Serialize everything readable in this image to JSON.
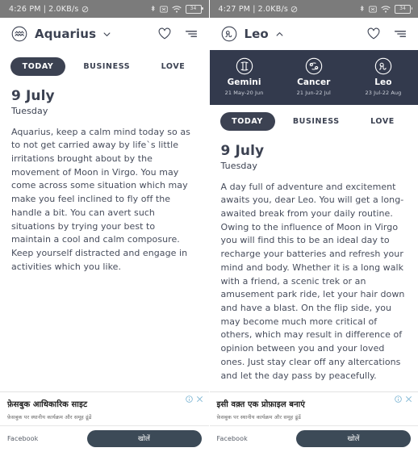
{
  "left": {
    "statusbar": {
      "time": "4:26 PM",
      "separator": "|",
      "netspeed": "2.0KB/s",
      "battery_level": "34",
      "icons": [
        "bluetooth-icon",
        "no-sim-icon",
        "wifi-icon",
        "battery-icon"
      ]
    },
    "header": {
      "sign": "Aquarius",
      "sign_icon": "aquarius-icon",
      "chevron": "chevron-down-icon",
      "favorite_icon": "heart-icon",
      "menu_icon": "filter-icon"
    },
    "tabs": [
      {
        "label": "TODAY",
        "active": true
      },
      {
        "label": "BUSINESS",
        "active": false
      },
      {
        "label": "LOVE",
        "active": false
      }
    ],
    "horoscope": {
      "date": "9 July",
      "weekday": "Tuesday",
      "text": "Aquarius, keep a calm mind today so as to not get carried away by life`s little irritations brought about by the movement of Moon in Virgo. You may come across some situation which may make you feel inclined to fly off the handle a bit. You can avert such situations by trying your best to maintain a cool and calm composure. Keep yourself distracted and engage in activities which you like."
    },
    "ad": {
      "title": "फ़ेसबुक आधिकारिक साइट",
      "subtitle": "फ़ेसबुक पर स्थानीय कार्यक्रम और समूह ढूंढें",
      "brand": "Facebook",
      "cta": "खोलें",
      "info_icon": "info-icon",
      "close_icon": "close-icon"
    }
  },
  "right": {
    "statusbar": {
      "time": "4:27 PM",
      "separator": "|",
      "netspeed": "2.0KB/s",
      "battery_level": "34",
      "icons": [
        "bluetooth-icon",
        "no-sim-icon",
        "wifi-icon",
        "battery-icon"
      ]
    },
    "header": {
      "sign": "Leo",
      "sign_icon": "leo-icon",
      "chevron": "chevron-up-icon",
      "favorite_icon": "heart-icon",
      "menu_icon": "filter-icon"
    },
    "zodiac_picker": [
      {
        "name": "Gemini",
        "range": "21 May-20 Jun",
        "icon": "gemini-icon"
      },
      {
        "name": "Cancer",
        "range": "21 Jun-22 Jul",
        "icon": "cancer-icon"
      },
      {
        "name": "Leo",
        "range": "23 Jul-22 Aug",
        "icon": "leo-icon"
      }
    ],
    "tabs": [
      {
        "label": "TODAY",
        "active": true
      },
      {
        "label": "BUSINESS",
        "active": false
      },
      {
        "label": "LOVE",
        "active": false
      }
    ],
    "horoscope": {
      "date": "9 July",
      "weekday": "Tuesday",
      "text": "A day full of adventure and excitement awaits you, dear Leo. You will get a long-awaited break from your daily routine. Owing to the influence of Moon in Virgo you will find this to be an ideal day to recharge your batteries and refresh your mind and body. Whether it is a long walk with a friend, a scenic trek or an amusement park ride, let your hair down and have a blast. On the flip side, you may become much more critical of others, which may result in difference of opinion between you and your loved ones. Just stay clear off any altercations and let the day pass by peacefully."
    },
    "ad": {
      "title": "इसी वक़्त एक प्रोफ़ाइल बनाएं",
      "subtitle": "फ़ेसबुक पर स्थानीय कार्यक्रम और समूह ढूंढें",
      "brand": "Facebook",
      "cta": "खोलें",
      "info_icon": "info-icon",
      "close_icon": "close-icon"
    }
  },
  "colors": {
    "statusbar_bg": "#7b7b7b",
    "dark": "#3c4252",
    "strip_bg": "#333a4d",
    "body_text": "#474d5c",
    "ad_cta": "#3c4a57",
    "ad_icon": "#7fb7d4"
  }
}
